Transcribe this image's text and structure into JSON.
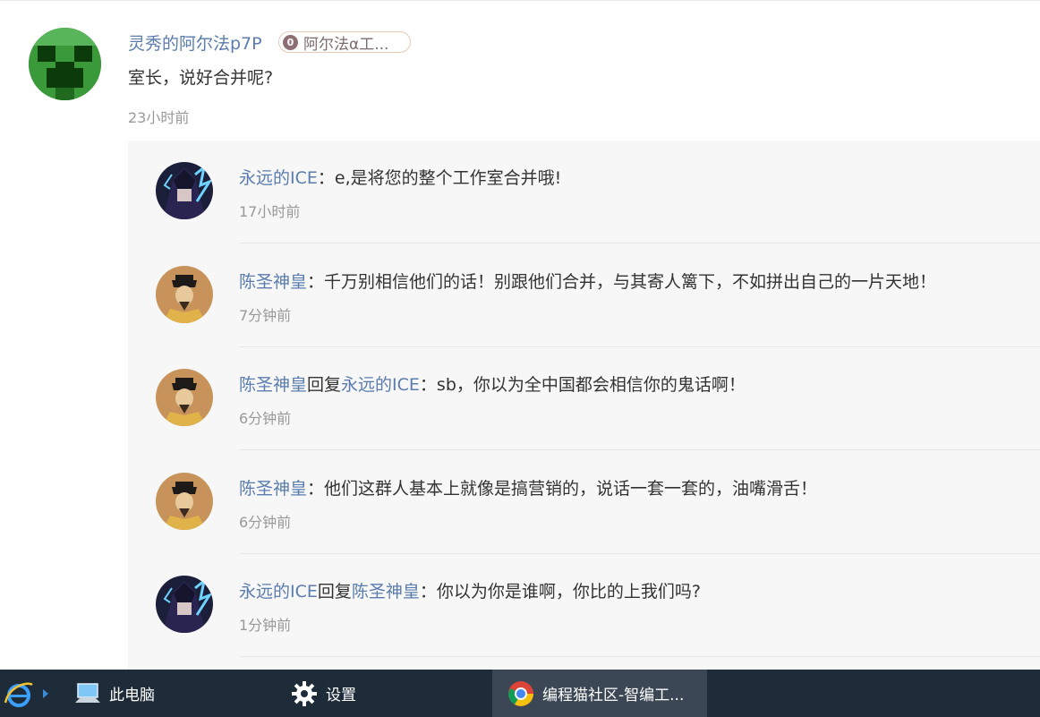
{
  "main_comment": {
    "author": "灵秀的阿尔法p7P",
    "badge_level": "0",
    "badge_text": "阿尔法α工...",
    "text": "室长，说好合并呢?",
    "time": "23小时前"
  },
  "replies": [
    {
      "user": "永远的ICE",
      "reply_word": "",
      "target": "",
      "text": "：e,是将您的整个工作室合并哦!",
      "time": "17小时前",
      "avatar": "anime"
    },
    {
      "user": "陈圣神皇",
      "reply_word": "",
      "target": "",
      "text": "：千万别相信他们的话！别跟他们合并，与其寄人篱下，不如拼出自己的一片天地！",
      "time": "7分钟前",
      "avatar": "emperor"
    },
    {
      "user": "陈圣神皇",
      "reply_word": "回复",
      "target": "永远的ICE",
      "text": "：sb，你以为全中国都会相信你的鬼话啊！",
      "time": "6分钟前",
      "avatar": "emperor"
    },
    {
      "user": "陈圣神皇",
      "reply_word": "",
      "target": "",
      "text": "：他们这群人基本上就像是搞营销的，说话一套一套的，油嘴滑舌！",
      "time": "6分钟前",
      "avatar": "emperor"
    },
    {
      "user": "永远的ICE",
      "reply_word": "回复",
      "target": "陈圣神皇",
      "text": "：你以为你是谁啊，你比的上我们吗?",
      "time": "1分钟前",
      "avatar": "anime"
    }
  ],
  "taskbar": {
    "items": [
      {
        "label": "此电脑",
        "icon": "computer-icon"
      },
      {
        "label": "设置",
        "icon": "gear-icon"
      },
      {
        "label": "编程猫社区-智编工...",
        "icon": "chrome-icon",
        "active": true
      }
    ]
  },
  "colors": {
    "username": "#5a7cae",
    "text": "#333333",
    "time": "#999999",
    "panel": "#f7f7f7",
    "taskbar": "#1e2c3a"
  }
}
